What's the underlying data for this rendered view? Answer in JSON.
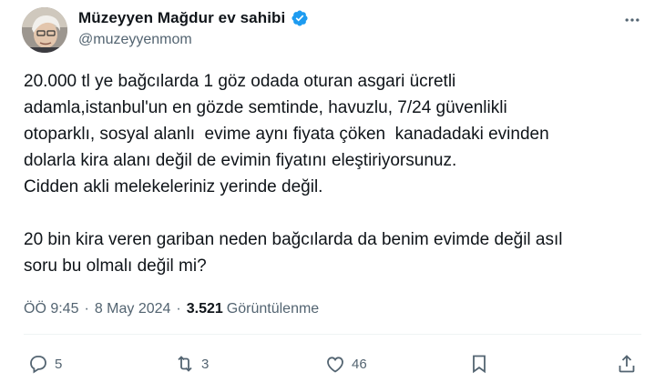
{
  "tweet": {
    "author": {
      "display_name": "Müzeyyen Mağdur ev sahibi",
      "handle": "@muzeyyenmom",
      "verified": true,
      "verified_color": "#1d9bf0"
    },
    "paragraphs": [
      [
        "20.000 tl ye bağcılarda 1 göz odada oturan asgari ücretli",
        "adamla,istanbul'un en gözde semtinde, havuzlu, 7/24 güvenlikli",
        "otoparklı, sosyal alanlı  evime aynı fiyata çöken  kanadadaki evinden",
        "dolarla kira alanı değil de evimin fiyatını eleştiriyorsunuz.",
        "Cidden akli melekeleriniz yerinde değil."
      ],
      [
        "20 bin kira veren gariban neden bağcılarda da benim evimde değil asıl",
        "soru bu olmalı değil mi?"
      ]
    ],
    "time": "ÖÖ 9:45",
    "date": "8 May 2024",
    "views_count": "3.521",
    "views_label": "Görüntülenme",
    "actions": {
      "replies": "5",
      "reposts": "3",
      "likes": "46"
    },
    "icons": [
      "verified-badge-icon",
      "more-options-icon",
      "reply-icon",
      "repost-icon",
      "like-icon",
      "bookmark-icon",
      "share-icon"
    ]
  }
}
